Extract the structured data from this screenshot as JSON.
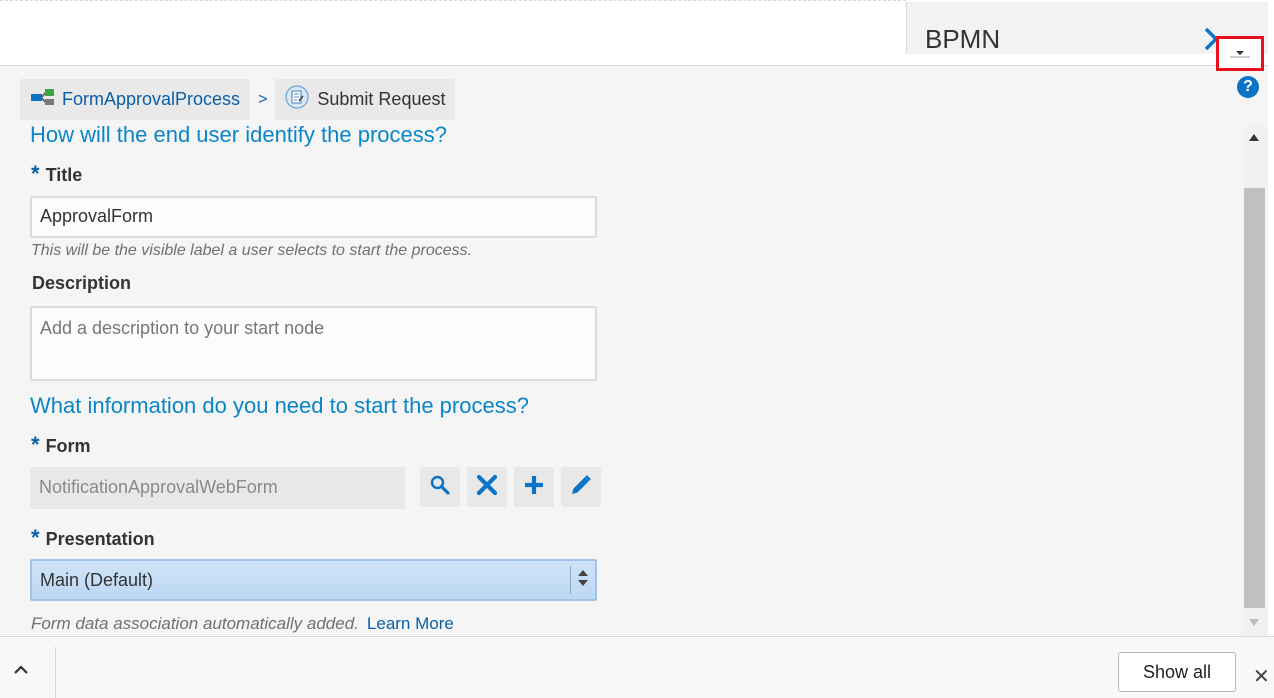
{
  "panel": {
    "title": "BPMN"
  },
  "breadcrumb": {
    "process": "FormApprovalProcess",
    "separator": ">",
    "current": "Submit Request"
  },
  "sections": {
    "identify_heading": "How will the end user identify the process?",
    "info_heading": "What information do you need to start the process?"
  },
  "fields": {
    "required_marker": "*",
    "title_label": "Title",
    "title_value": "ApprovalForm",
    "title_hint": "This will be the visible label a user selects to start the process.",
    "description_label": "Description",
    "description_placeholder": "Add a description to your start node",
    "form_label": "Form",
    "form_value": "NotificationApprovalWebForm",
    "presentation_label": "Presentation",
    "presentation_value": "Main (Default)",
    "association_note": "Form data association automatically added.",
    "learn_more": "Learn More"
  },
  "help": {
    "glyph": "?"
  },
  "bottom": {
    "show_all": "Show all",
    "close": "✕"
  },
  "colors": {
    "accent": "#0b85c9",
    "link": "#0b5fa8",
    "highlight": "#e8101c"
  }
}
